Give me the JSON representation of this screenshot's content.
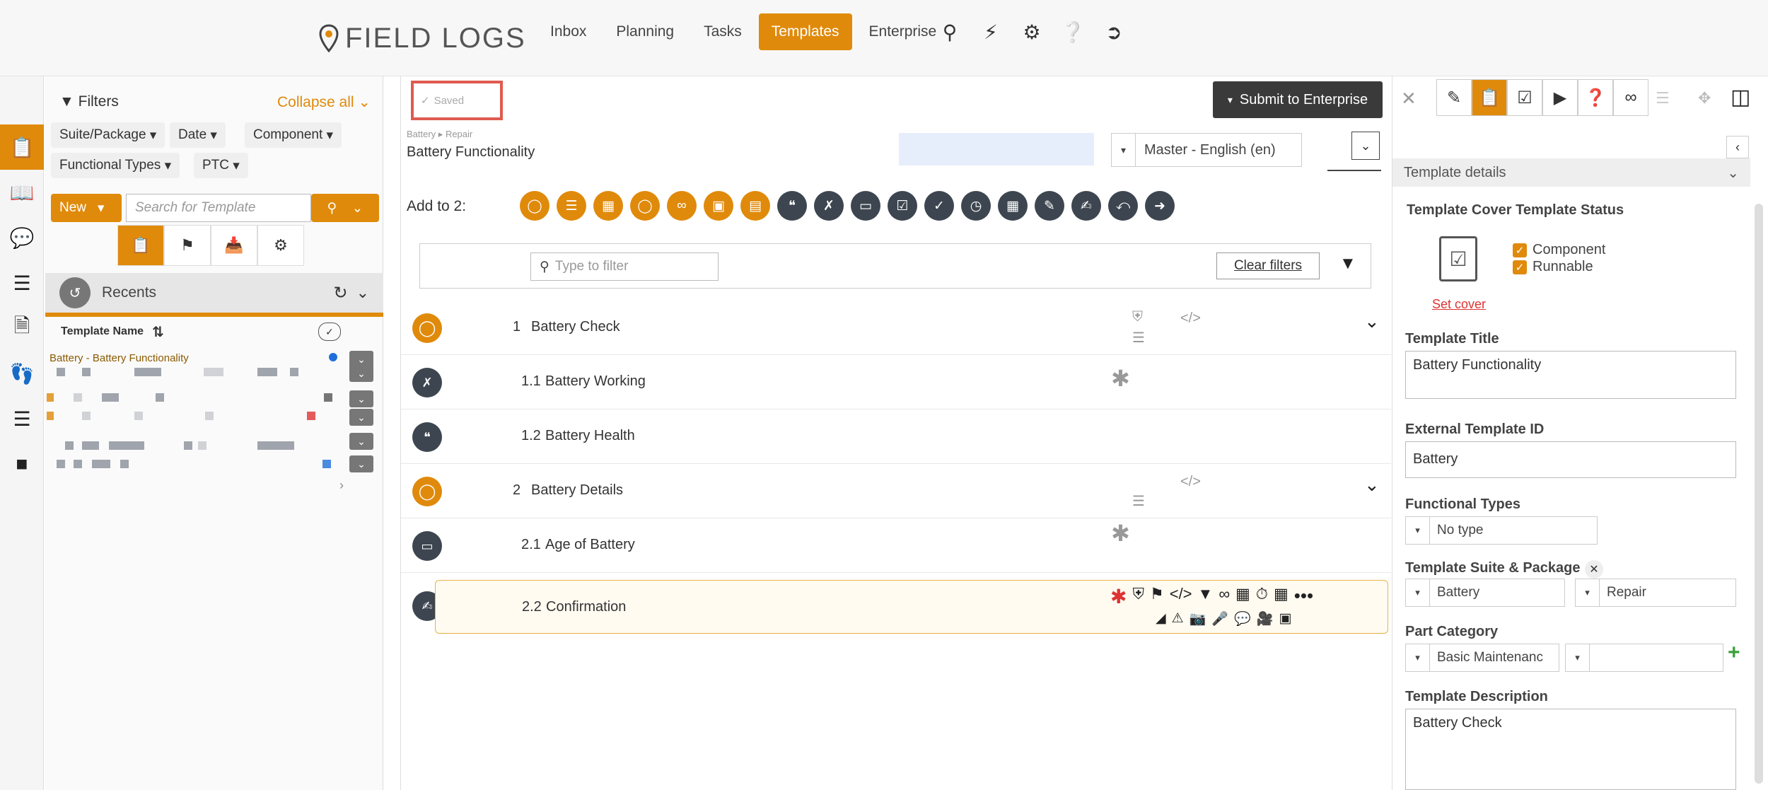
{
  "app": {
    "logo_text": "FIELD LOGS"
  },
  "nav": {
    "items": [
      {
        "label": "Inbox"
      },
      {
        "label": "Planning"
      },
      {
        "label": "Tasks"
      },
      {
        "label": "Templates",
        "active": true
      },
      {
        "label": "Enterprise"
      }
    ]
  },
  "filters": {
    "title": "Filters",
    "collapse_all": "Collapse all",
    "chips": [
      "Suite/Package",
      "Date",
      "Component",
      "Functional Types",
      "PTC"
    ],
    "new_label": "New",
    "search_placeholder": "Search for Template",
    "recents_label": "Recents",
    "col_header": "Template Name",
    "first_row": "Battery - Battery Functionality"
  },
  "editor": {
    "saved_label": "Saved",
    "submit_label": "Submit to Enterprise",
    "crumb_suite": "Battery",
    "crumb_package": "Repair",
    "template_name": "Battery Functionality",
    "language": "Master - English (en)",
    "add_to_label": "Add to 2:",
    "filter_placeholder": "Type to filter",
    "clear_filters": "Clear filters",
    "rows": [
      {
        "num": "1",
        "label": "Battery Check"
      },
      {
        "num": "1.1",
        "label": "Battery Working"
      },
      {
        "num": "1.2",
        "label": "Battery Health"
      },
      {
        "num": "2",
        "label": "Battery Details"
      },
      {
        "num": "2.1",
        "label": "Age of Battery"
      },
      {
        "num": "2.2",
        "label": "Confirmation"
      }
    ]
  },
  "details": {
    "section_title": "Template details",
    "cover_status_label": "Template Cover Template Status",
    "component_label": "Component",
    "runnable_label": "Runnable",
    "set_cover": "Set cover",
    "title_label": "Template Title",
    "title_value": "Battery Functionality",
    "external_id_label": "External Template ID",
    "external_id_value": "Battery",
    "functional_types_label": "Functional Types",
    "functional_types_value": "No type",
    "suite_package_label": "Template Suite & Package",
    "suite_value": "Battery",
    "package_value": "Repair",
    "part_category_label": "Part Category",
    "part_category_value": "Basic Maintenanc",
    "description_label": "Template Description",
    "description_value": "Battery Check"
  },
  "colors": {
    "accent": "#e08a0b",
    "dark_icon": "#3d4650",
    "saved_outline": "#e05a4f"
  }
}
